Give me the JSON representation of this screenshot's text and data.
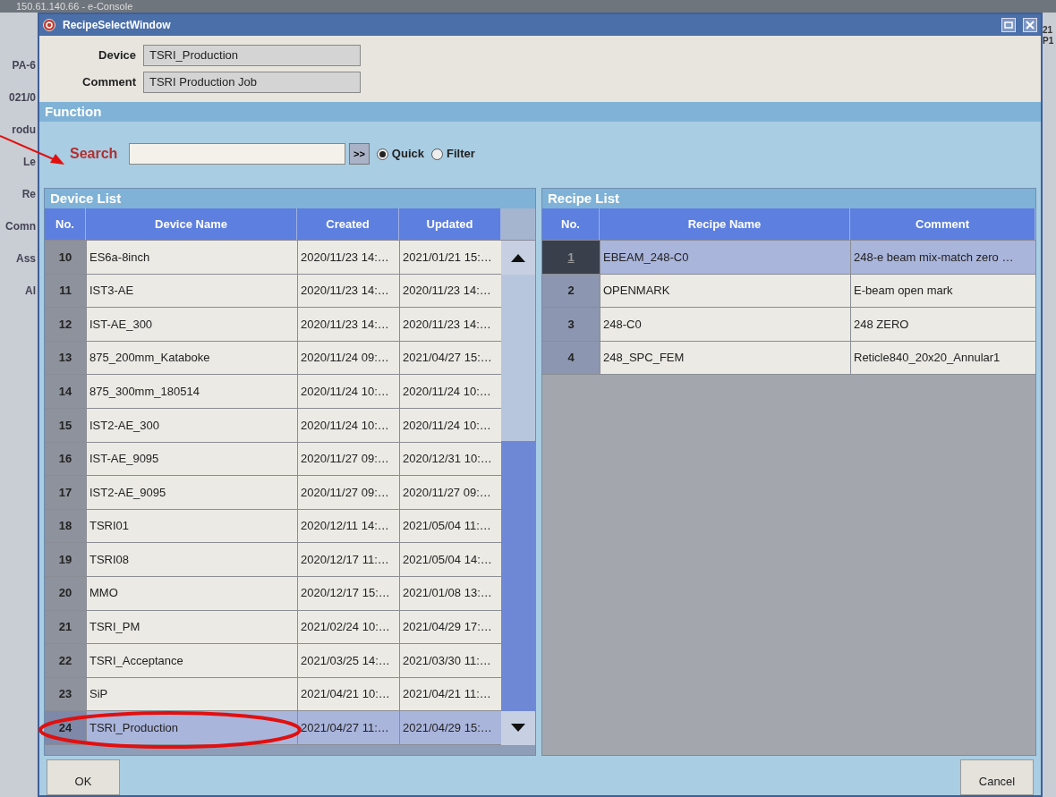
{
  "background_window": {
    "title": "150.61.140.66 - e-Console",
    "left_fragments": [
      "PA-6",
      "021/0",
      "rodu",
      "Le",
      "Re",
      "Comn",
      "Ass",
      "Al"
    ],
    "right_fragments": [
      "21",
      "P1"
    ]
  },
  "window": {
    "title": "RecipeSelectWindow"
  },
  "device_field": {
    "label": "Device",
    "value": "TSRI_Production"
  },
  "comment_field": {
    "label": "Comment",
    "value": "TSRI Production Job"
  },
  "function": {
    "title": "Function",
    "search_label": "Search",
    "go_button": ">>",
    "modes": [
      {
        "label": "Quick",
        "selected": true
      },
      {
        "label": "Filter",
        "selected": false
      }
    ]
  },
  "device_list": {
    "title": "Device List",
    "columns": [
      "No.",
      "Device Name",
      "Created",
      "Updated"
    ],
    "rows": [
      {
        "no": "10",
        "name": "ES6a-8inch",
        "created": "2020/11/23 14:…",
        "updated": "2021/01/21 15:…",
        "selected": false
      },
      {
        "no": "11",
        "name": "IST3-AE",
        "created": "2020/11/23 14:…",
        "updated": "2020/11/23 14:…",
        "selected": false
      },
      {
        "no": "12",
        "name": "IST-AE_300",
        "created": "2020/11/23 14:…",
        "updated": "2020/11/23 14:…",
        "selected": false
      },
      {
        "no": "13",
        "name": "875_200mm_Kataboke",
        "created": "2020/11/24 09:…",
        "updated": "2021/04/27 15:…",
        "selected": false
      },
      {
        "no": "14",
        "name": "875_300mm_180514",
        "created": "2020/11/24 10:…",
        "updated": "2020/11/24 10:…",
        "selected": false
      },
      {
        "no": "15",
        "name": "IST2-AE_300",
        "created": "2020/11/24 10:…",
        "updated": "2020/11/24 10:…",
        "selected": false
      },
      {
        "no": "16",
        "name": "IST-AE_9095",
        "created": "2020/11/27 09:…",
        "updated": "2020/12/31 10:…",
        "selected": false
      },
      {
        "no": "17",
        "name": "IST2-AE_9095",
        "created": "2020/11/27 09:…",
        "updated": "2020/11/27 09:…",
        "selected": false
      },
      {
        "no": "18",
        "name": "TSRI01",
        "created": "2020/12/11 14:…",
        "updated": "2021/05/04 11:…",
        "selected": false
      },
      {
        "no": "19",
        "name": "TSRI08",
        "created": "2020/12/17 11:…",
        "updated": "2021/05/04 14:…",
        "selected": false
      },
      {
        "no": "20",
        "name": "MMO",
        "created": "2020/12/17 15:…",
        "updated": "2021/01/08 13:…",
        "selected": false
      },
      {
        "no": "21",
        "name": "TSRI_PM",
        "created": "2021/02/24 10:…",
        "updated": "2021/04/29 17:…",
        "selected": false
      },
      {
        "no": "22",
        "name": "TSRI_Acceptance",
        "created": "2021/03/25 14:…",
        "updated": "2021/03/30 11:…",
        "selected": false
      },
      {
        "no": "23",
        "name": "SiP",
        "created": "2021/04/21 10:…",
        "updated": "2021/04/21 11:…",
        "selected": false
      },
      {
        "no": "24",
        "name": "TSRI_Production",
        "created": "2021/04/27 11:…",
        "updated": "2021/04/29 15:…",
        "selected": true
      }
    ]
  },
  "recipe_list": {
    "title": "Recipe List",
    "columns": [
      "No.",
      "Recipe Name",
      "Comment"
    ],
    "rows": [
      {
        "no": "1",
        "name": "EBEAM_248-C0",
        "comment": "248-e beam mix-match zero …",
        "selected": true
      },
      {
        "no": "2",
        "name": "OPENMARK",
        "comment": "E-beam open mark",
        "selected": false
      },
      {
        "no": "3",
        "name": "248-C0",
        "comment": "248 ZERO",
        "selected": false
      },
      {
        "no": "4",
        "name": "248_SPC_FEM",
        "comment": "Reticle840_20x20_Annular1",
        "selected": false
      }
    ]
  },
  "buttons": [
    {
      "label": "OK"
    },
    {
      "label": "Cancel"
    }
  ]
}
